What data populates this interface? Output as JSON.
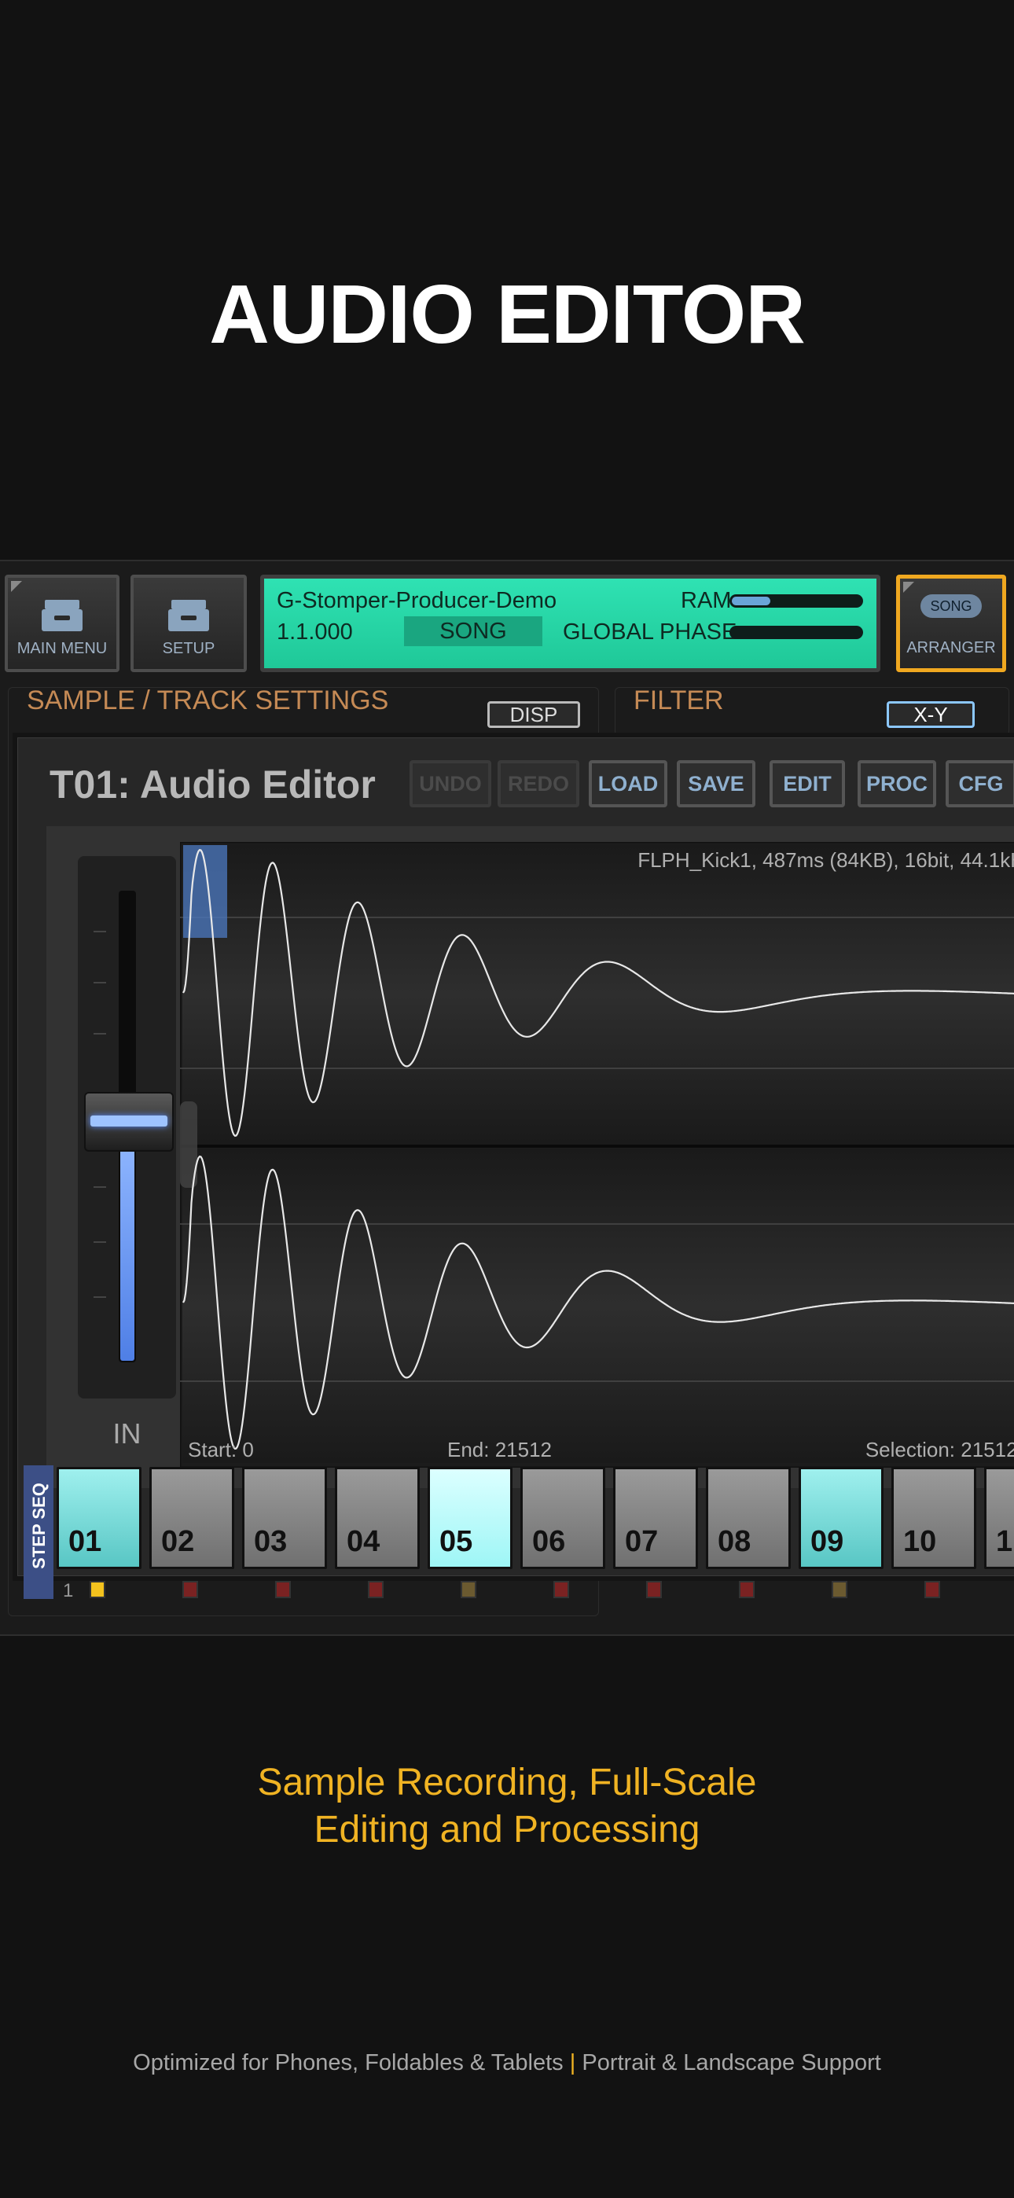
{
  "headline": "AUDIO EDITOR",
  "toolbar": {
    "main_menu": "MAIN MENU",
    "setup": "SETUP",
    "lcd": {
      "project": "G-Stomper-Producer-Demo",
      "position": "1.1.000",
      "mode": "SONG",
      "ram_label": "RAM",
      "ram_fill": 0.3,
      "phase_label": "GLOBAL PHASE"
    },
    "arranger_chip": "SONG",
    "arranger_label": "ARRANGER"
  },
  "sections": {
    "sample_track": "SAMPLE / TRACK SETTINGS",
    "disp": "DISP",
    "filter": "FILTER",
    "xy": "X-Y"
  },
  "editor": {
    "title": "T01: Audio Editor",
    "buttons": [
      {
        "label": "UNDO",
        "enabled": false
      },
      {
        "label": "REDO",
        "enabled": false
      },
      {
        "label": "LOAD",
        "enabled": true
      },
      {
        "label": "SAVE",
        "enabled": true
      },
      {
        "label": "EDIT",
        "enabled": true
      },
      {
        "label": "PROC",
        "enabled": true
      },
      {
        "label": "CFG",
        "enabled": true
      }
    ],
    "fader_label": "IN",
    "sample_info": "FLPH_Kick1, 487ms (84KB), 16bit, 44.1kH",
    "start": "Start: 0",
    "end": "End: 21512",
    "selection": "Selection: 21512 /"
  },
  "sequencer": {
    "label": "STEP SEQ",
    "bar_number": "1",
    "steps": [
      "01",
      "02",
      "03",
      "04",
      "05",
      "06",
      "07",
      "08",
      "09",
      "10",
      "1"
    ]
  },
  "tagline": [
    "Sample Recording, Full-Scale",
    "Editing and Processing"
  ],
  "footer": {
    "left": "Optimized for Phones, Foldables & Tablets",
    "separator": "|",
    "right": "Portrait & Landscape Support"
  },
  "colors": {
    "accent": "#f0b323",
    "lcd": "#26d6a8",
    "section_label": "#c58a55",
    "step_active": "#58c6c4"
  }
}
